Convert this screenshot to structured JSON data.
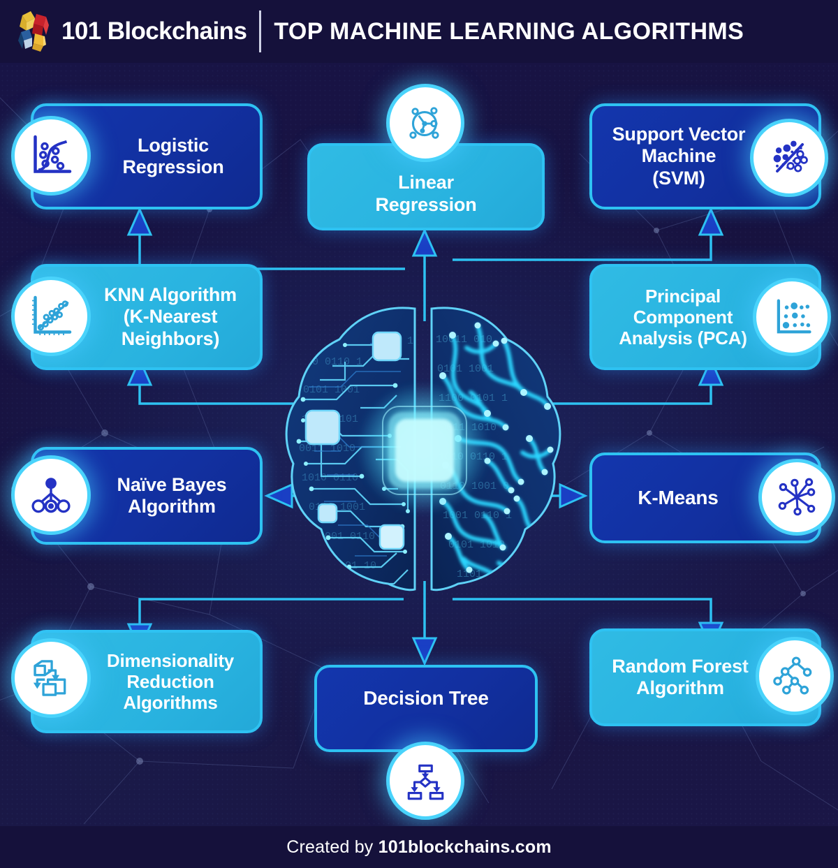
{
  "header": {
    "brand": "101 Blockchains",
    "title": "TOP MACHINE LEARNING ALGORITHMS",
    "logo_icon": "isometric-cubes-logo",
    "logo_colors": [
      "#e8c03a",
      "#c8222b",
      "#1c4f8a",
      "#f0bc38"
    ]
  },
  "footer": {
    "prefix": "Created by ",
    "site": "101blockchains.com"
  },
  "center": {
    "graphic": "ai-brain-circuit",
    "description": "Digital brain: left hemisphere circuit board, right hemisphere neural pathways, glowing central chip"
  },
  "colors": {
    "background": "#17123f",
    "header_bar": "#15113b",
    "card_dark": "#1230a0",
    "card_light": "#2ab3e0",
    "card_border": "#2ec2f2",
    "wire": "#2ec2f2",
    "arrowhead_fill": "#1a3fc4",
    "icon_bubble_border": "#49d3fb",
    "icon_dark": "#2432c4",
    "icon_light": "#2ea3d8",
    "text": "#ffffff"
  },
  "nodes": [
    {
      "id": "logistic-regression",
      "label": "Logistic\nRegression",
      "style": "dark",
      "icon": "logistic-curve-scatter-icon",
      "icon_side": "left",
      "position": "top-left"
    },
    {
      "id": "knn-algorithm",
      "label": "KNN Algorithm\n(K-Nearest\nNeighbors)",
      "style": "light",
      "icon": "scatter-trendline-icon",
      "icon_side": "left",
      "position": "middle-left"
    },
    {
      "id": "naive-bayes-algorithm",
      "label": "Naïve Bayes\nAlgorithm",
      "style": "dark",
      "icon": "bayes-network-nodes-icon",
      "icon_side": "left",
      "position": "center-left"
    },
    {
      "id": "dimensionality-reduction-algorithms",
      "label": "Dimensionality\nReduction\nAlgorithms",
      "style": "light",
      "icon": "stacked-boxes-arrows-icon",
      "icon_side": "left",
      "position": "bottom-left"
    },
    {
      "id": "linear-regression",
      "label": "Linear\nRegression",
      "style": "light",
      "icon": "node-network-circle-icon",
      "icon_side": "top",
      "position": "top-center"
    },
    {
      "id": "decision-tree",
      "label": "Decision Tree",
      "style": "dark",
      "icon": "flowchart-decision-icon",
      "icon_side": "bottom",
      "position": "bottom-center"
    },
    {
      "id": "support-vector-machine",
      "label": "Support Vector\nMachine\n(SVM)",
      "style": "dark",
      "icon": "svm-separating-hyperplane-icon",
      "icon_side": "right",
      "position": "top-right"
    },
    {
      "id": "principal-component-analysis",
      "label": "Principal\nComponent\nAnalysis (PCA)",
      "style": "light",
      "icon": "pca-scatter-axes-icon",
      "icon_side": "right",
      "position": "middle-right"
    },
    {
      "id": "k-means",
      "label": "K-Means",
      "style": "dark",
      "icon": "kmeans-cluster-star-icon",
      "icon_side": "right",
      "position": "center-right"
    },
    {
      "id": "random-forest-algorithm",
      "label": "Random Forest\nAlgorithm",
      "style": "light",
      "icon": "decision-tree-branches-icon",
      "icon_side": "right",
      "position": "bottom-right"
    }
  ],
  "connectors": [
    {
      "from": "center-brain",
      "to": "logistic-regression",
      "direction": "up"
    },
    {
      "from": "center-brain",
      "to": "knn-algorithm",
      "direction": "up"
    },
    {
      "from": "center-brain",
      "to": "naive-bayes-algorithm",
      "direction": "left"
    },
    {
      "from": "center-brain",
      "to": "dimensionality-reduction-algorithms",
      "direction": "down"
    },
    {
      "from": "center-brain",
      "to": "linear-regression",
      "direction": "up"
    },
    {
      "from": "center-brain",
      "to": "decision-tree",
      "direction": "down"
    },
    {
      "from": "center-brain",
      "to": "support-vector-machine",
      "direction": "up"
    },
    {
      "from": "center-brain",
      "to": "principal-component-analysis",
      "direction": "up"
    },
    {
      "from": "center-brain",
      "to": "k-means",
      "direction": "right"
    },
    {
      "from": "center-brain",
      "to": "random-forest-algorithm",
      "direction": "down"
    }
  ]
}
